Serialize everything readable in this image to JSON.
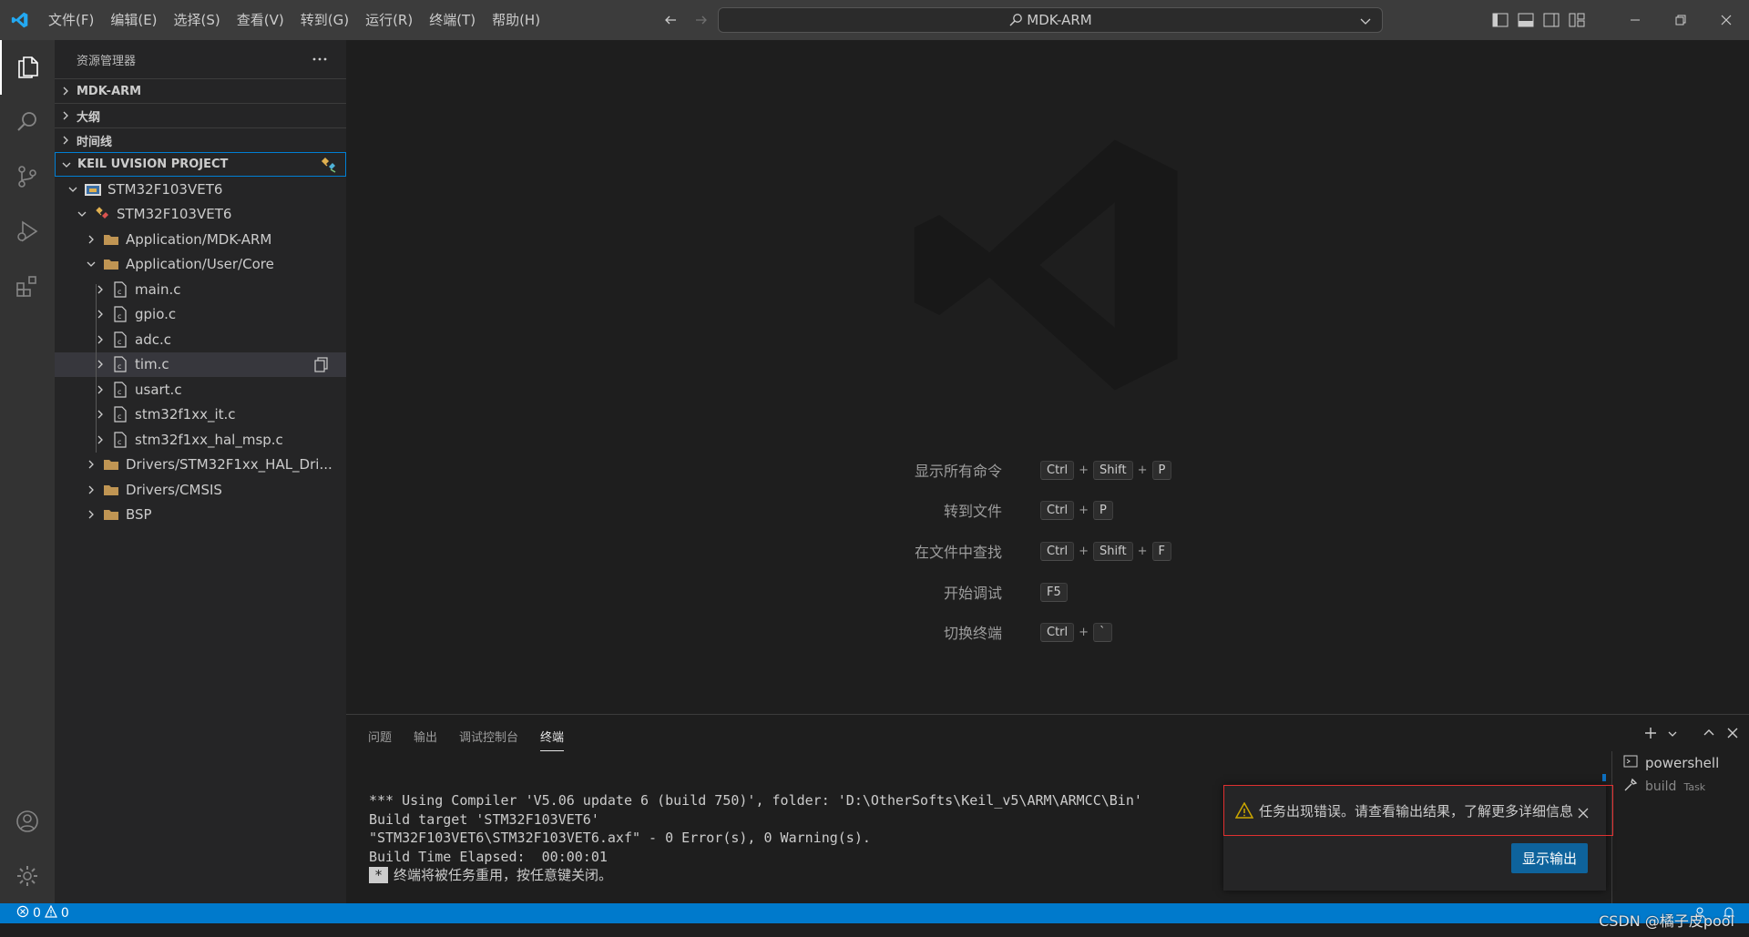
{
  "titlebar": {
    "menu": [
      "文件(F)",
      "编辑(E)",
      "选择(S)",
      "查看(V)",
      "转到(G)",
      "运行(R)",
      "终端(T)",
      "帮助(H)"
    ],
    "search_text": "MDK-ARM"
  },
  "sidebar": {
    "title": "资源管理器",
    "sections": [
      "MDK-ARM",
      "大纲",
      "时间线",
      "KEIL UVISION PROJECT"
    ],
    "tree": {
      "project": "STM32F103VET6",
      "target": "STM32F103VET6",
      "groups": [
        "Application/MDK-ARM",
        "Application/User/Core"
      ],
      "files": [
        "main.c",
        "gpio.c",
        "adc.c",
        "tim.c",
        "usart.c",
        "stm32f1xx_it.c",
        "stm32f1xx_hal_msp.c"
      ],
      "more_groups": [
        "Drivers/STM32F1xx_HAL_Dri...",
        "Drivers/CMSIS",
        "BSP"
      ]
    }
  },
  "editor": {
    "shortcuts": [
      {
        "label": "显示所有命令",
        "keys": [
          "Ctrl",
          "Shift",
          "P"
        ]
      },
      {
        "label": "转到文件",
        "keys": [
          "Ctrl",
          "P"
        ]
      },
      {
        "label": "在文件中查找",
        "keys": [
          "Ctrl",
          "Shift",
          "F"
        ]
      },
      {
        "label": "开始调试",
        "keys": [
          "F5"
        ]
      },
      {
        "label": "切换终端",
        "keys": [
          "Ctrl",
          "`"
        ]
      }
    ]
  },
  "panel": {
    "tabs": [
      "问题",
      "输出",
      "调试控制台",
      "终端"
    ],
    "active_tab": "终端",
    "terminal_lines": [
      "*** Using Compiler 'V5.06 update 6 (build 750)', folder: 'D:\\OtherSofts\\Keil_v5\\ARM\\ARMCC\\Bin'",
      "Build target 'STM32F103VET6'",
      "\"STM32F103VET6\\STM32F103VET6.axf\" - 0 Error(s), 0 Warning(s).",
      "Build Time Elapsed:  00:00:01"
    ],
    "terminal_badge": "*",
    "terminal_reuse_msg": "终端将被任务重用，按任意键关闭。",
    "term_list": [
      "powershell",
      "build",
      "Task"
    ]
  },
  "notification": {
    "message": "任务出现错误。请查看输出结果，了解更多详细信息",
    "button": "显示输出"
  },
  "statusbar": {
    "errors": "0",
    "warnings": "0"
  },
  "watermark": "CSDN @橘子皮pool",
  "colors": {
    "accent": "#007acc",
    "toast_border": "#e03030",
    "folder": "#c09553"
  }
}
